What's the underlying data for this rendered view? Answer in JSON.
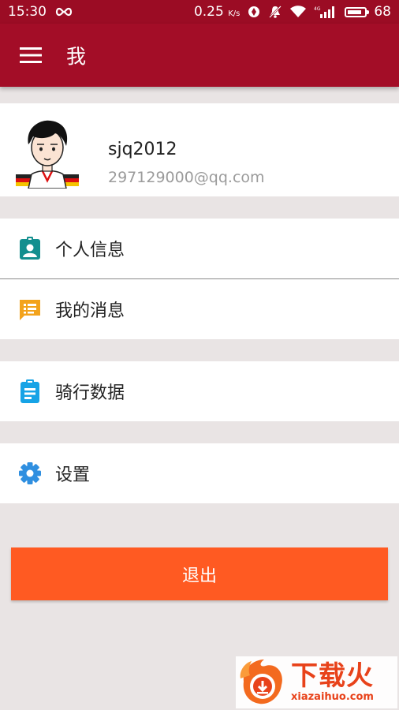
{
  "status_bar": {
    "time": "15:30",
    "speed": "0.25",
    "speed_unit": "K/s",
    "network": "4G",
    "battery": "68"
  },
  "app_bar": {
    "title": "我"
  },
  "profile": {
    "username": "sjq2012",
    "email": "297129000@qq.com"
  },
  "menu": {
    "personal_info": {
      "label": "个人信息",
      "icon": "contact-card-icon",
      "color": "#138f8f"
    },
    "my_messages": {
      "label": "我的消息",
      "icon": "chat-icon",
      "color": "#f3a31c"
    },
    "ride_data": {
      "label": "骑行数据",
      "icon": "clipboard-icon",
      "color": "#16a3e6"
    },
    "settings": {
      "label": "设置",
      "icon": "gear-icon",
      "color": "#2f8fe0"
    }
  },
  "logout": {
    "label": "退出",
    "color": "#ff5a22"
  },
  "watermark": {
    "text": "下载火",
    "url": "xiazaihuo.com"
  },
  "colors": {
    "primary": "#a30d27",
    "background": "#e9e4e4"
  }
}
